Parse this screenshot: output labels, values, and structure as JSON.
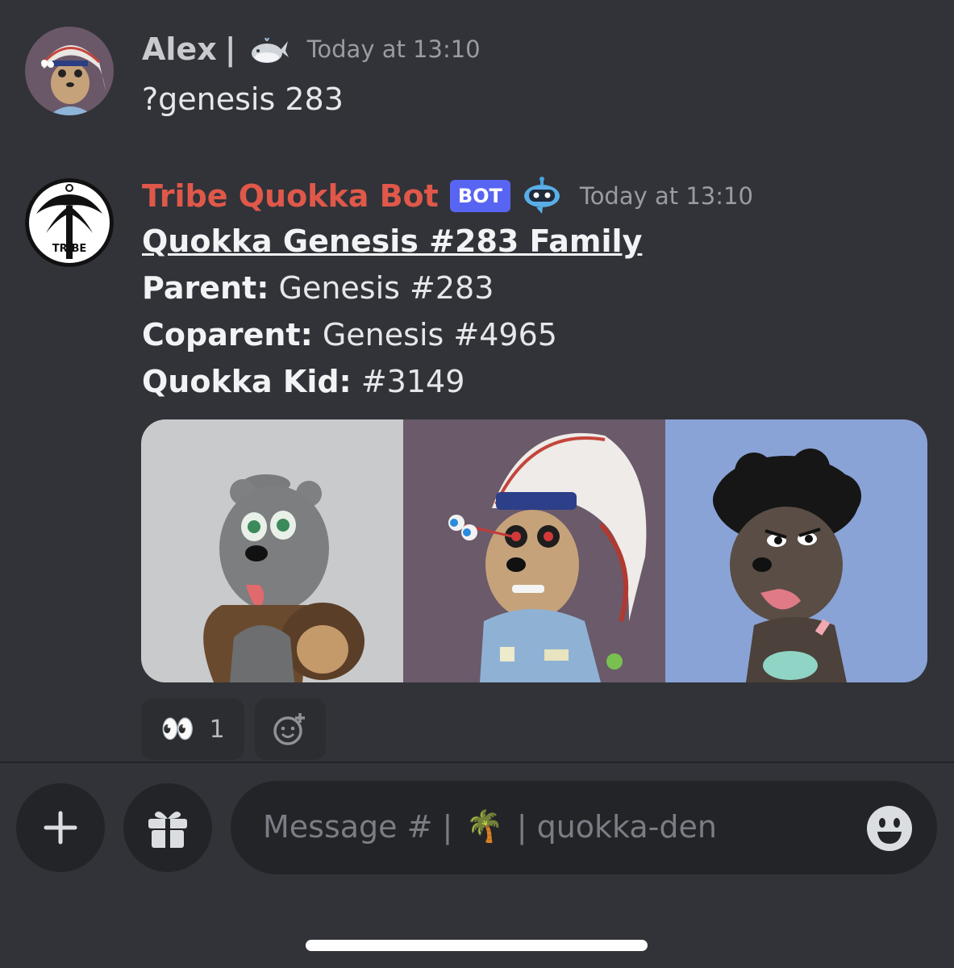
{
  "messages": [
    {
      "author": "Alex",
      "author_separator": "|",
      "author_emoji_icon": "whale-icon",
      "timestamp": "Today at 13:10",
      "text": "?genesis 283"
    },
    {
      "author": "Tribe Quokka Bot",
      "badge": "BOT",
      "badge_color": "#5865f2",
      "author_color": "#e0584a",
      "author_emoji_icon": "robot-icon",
      "timestamp": "Today at 13:10",
      "embed": {
        "title": "Quokka Genesis #283 Family",
        "fields": [
          {
            "label": "Parent:",
            "value": "Genesis #283"
          },
          {
            "label": "Coparent:",
            "value": "Genesis #4965"
          },
          {
            "label": "Quokka Kid:",
            "value": "#3149"
          }
        ],
        "images": [
          "grey-quokka-with-ape-image",
          "headdress-quokka-image",
          "afro-quokka-image"
        ]
      },
      "reactions": [
        {
          "emoji": "👀",
          "count": "1"
        }
      ],
      "add_reaction_icon": "add-reaction-icon"
    }
  ],
  "composer": {
    "add_icon": "plus-icon",
    "gift_icon": "gift-icon",
    "placeholder_prefix": "Message # |",
    "channel_emoji": "🌴",
    "placeholder_suffix": "| quokka-den",
    "emoji_icon": "smiley-icon"
  },
  "colors": {
    "background": "#313338",
    "composer_bg": "#232428",
    "bot_name": "#e0584a"
  }
}
